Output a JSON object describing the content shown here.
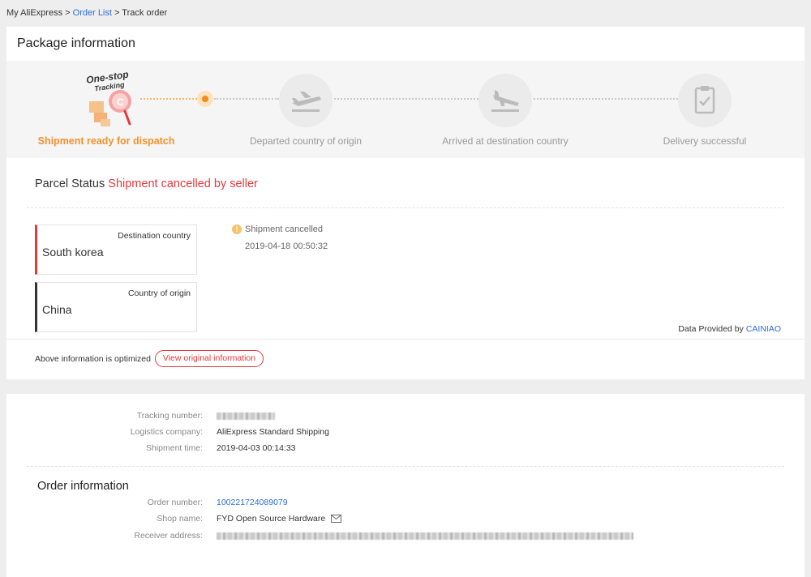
{
  "breadcrumb": {
    "home": "My AliExpress",
    "sep1": ">",
    "orders": "Order List",
    "sep2": ">",
    "current": "Track order"
  },
  "package": {
    "title": "Package information",
    "badge_line1": "One-stop",
    "badge_line2": "Tracking",
    "steps": [
      {
        "label": "Shipment ready for dispatch",
        "icon": "package-icon",
        "active": true
      },
      {
        "label": "Departed country of origin",
        "icon": "plane-takeoff-icon",
        "active": false
      },
      {
        "label": "Arrived at destination country",
        "icon": "plane-landing-icon",
        "active": false
      },
      {
        "label": "Delivery successful",
        "icon": "clipboard-check-icon",
        "active": false
      }
    ]
  },
  "parcel": {
    "status_label": "Parcel Status",
    "status_value": "Shipment cancelled by seller",
    "destination_label": "Destination country",
    "destination_value": "South korea",
    "origin_label": "Country of origin",
    "origin_value": "China",
    "event_title": "Shipment cancelled",
    "event_time": "2019-04-18 00:50:32",
    "data_provided_label": "Data Provided by",
    "data_provider": "CAINIAO",
    "optimized_note": "Above information is optimized",
    "view_original_label": "View original information"
  },
  "shipment": {
    "tracking_label": "Tracking number:",
    "logistics_label": "Logistics company:",
    "logistics_value": "AliExpress Standard Shipping",
    "shipment_time_label": "Shipment time:",
    "shipment_time_value": "2019-04-03 00:14:33"
  },
  "order": {
    "title": "Order information",
    "number_label": "Order number:",
    "number_value": "100221724089079",
    "shop_label": "Shop name:",
    "shop_value": "FYD Open Source Hardware",
    "receiver_label": "Receiver address:"
  },
  "colors": {
    "accent_orange": "#f2922e",
    "status_red": "#e4393c",
    "link_blue": "#2a6fd6"
  }
}
